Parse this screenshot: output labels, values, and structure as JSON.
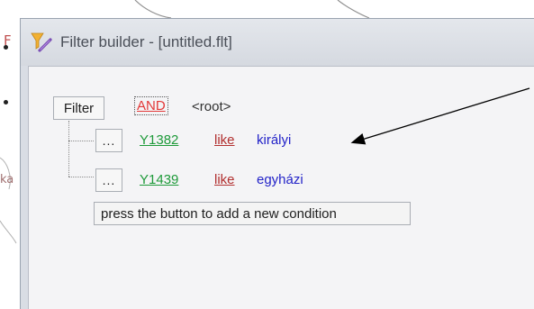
{
  "background": {
    "letter_f": "F",
    "letter_ka": "ka"
  },
  "window": {
    "title": "Filter builder - [untitled.flt]",
    "icon": "filter-funnel-icon"
  },
  "filter": {
    "root_button_label": "Filter",
    "group_operator": "AND",
    "root_label": "<root>",
    "conditions": [
      {
        "button_label": "...",
        "field": "Y1382",
        "operator": "like",
        "value": "királyi"
      },
      {
        "button_label": "...",
        "field": "Y1439",
        "operator": "like",
        "value": "egyházi"
      }
    ],
    "add_condition_label": "press the button to add a new condition"
  },
  "colors": {
    "group_operator": "#e23838",
    "field": "#1e9a3a",
    "operator": "#b23030",
    "value": "#2323c8"
  }
}
